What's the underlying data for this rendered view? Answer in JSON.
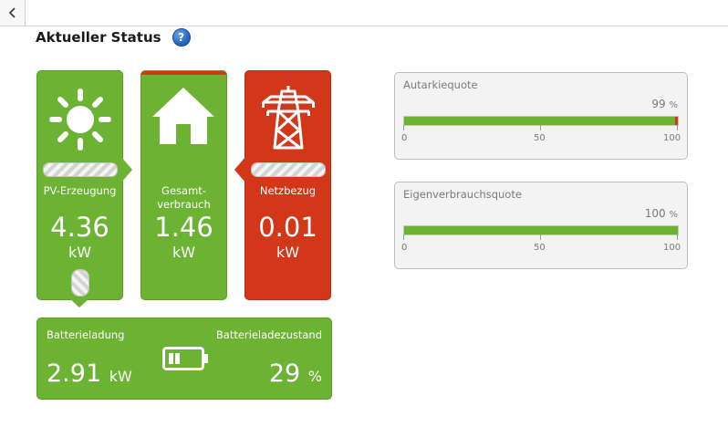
{
  "header": {
    "title": "Aktueller Status",
    "help_symbol": "?"
  },
  "tiles": {
    "pv": {
      "label": "PV-Erzeugung",
      "value": "4.36",
      "unit": "kW",
      "icon": "sun-icon"
    },
    "consumption": {
      "label_line1": "Gesamt-",
      "label_line2": "verbrauch",
      "value": "1.46",
      "unit": "kW",
      "icon": "house-icon"
    },
    "grid": {
      "label": "Netzbezug",
      "value": "0.01",
      "unit": "kW",
      "icon": "power-pylon-icon"
    }
  },
  "battery": {
    "charge_label": "Batterieladung",
    "charge_value": "2.91",
    "charge_unit": "kW",
    "soc_label": "Batterieladezustand",
    "soc_value": "29",
    "soc_unit": "%",
    "icon": "battery-icon"
  },
  "quotas": {
    "autarky": {
      "label": "Autarkiequote",
      "value": "99",
      "unit": "%",
      "fraction": 0.99,
      "ticks": [
        "0",
        "50",
        "100"
      ]
    },
    "self_consumption": {
      "label": "Eigenverbrauchsquote",
      "value": "100",
      "unit": "%",
      "fraction": 1.0,
      "ticks": [
        "0",
        "50",
        "100"
      ]
    }
  },
  "colors": {
    "green": "#6cb333",
    "red": "#d13718",
    "panel_bg": "#f3f3f3"
  }
}
